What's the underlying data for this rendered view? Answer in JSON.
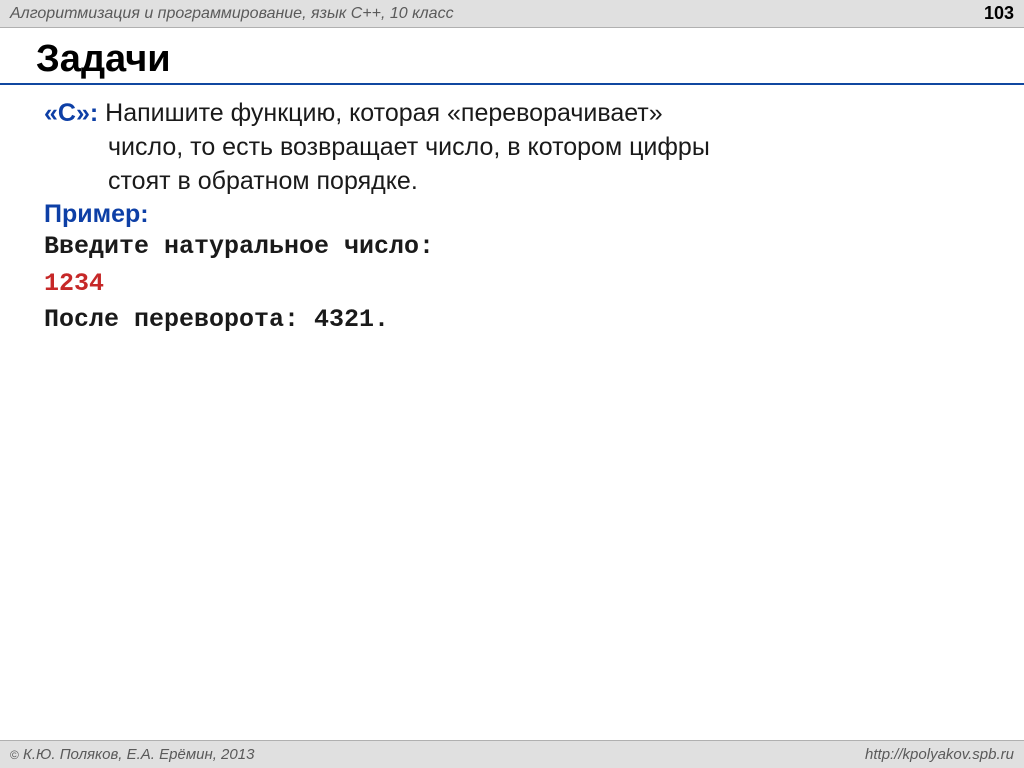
{
  "header": {
    "subject": "Алгоритмизация и программирование, язык  C++, 10 класс",
    "page_number": "103"
  },
  "title": "Задачи",
  "task": {
    "level": "«С»:",
    "line1": " Напишите функцию, которая «переворачивает»",
    "line2": "число, то есть возвращает число, в котором цифры",
    "line3": "стоят в обратном порядке."
  },
  "example": {
    "label": "Пример:",
    "prompt": "Введите натуральное число:",
    "input": "1234",
    "output": "После переворота: 4321."
  },
  "footer": {
    "copyright": " К.Ю. Поляков, Е.А. Ерёмин, 2013",
    "url": "http://kpolyakov.spb.ru"
  }
}
